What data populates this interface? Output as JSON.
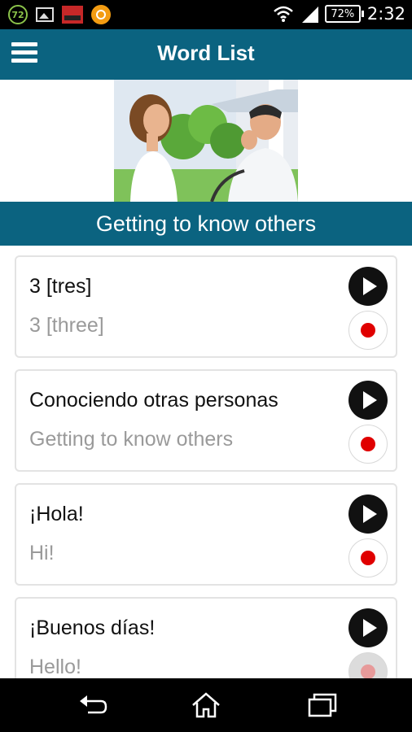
{
  "status_bar": {
    "notification_badge": "72",
    "battery": "72%",
    "time": "2:32",
    "icons": [
      "badge-72-icon",
      "gallery-icon",
      "book-app-icon",
      "orange-app-icon",
      "wifi-icon",
      "signal-icon",
      "battery-icon"
    ]
  },
  "app_bar": {
    "title": "Word List",
    "menu_icon": "hamburger-menu-icon"
  },
  "section": {
    "title": "Getting to know others"
  },
  "words": [
    {
      "spanish": "3 [tres]",
      "english": "3 [three]"
    },
    {
      "spanish": "Conociendo otras personas",
      "english": "Getting to know others"
    },
    {
      "spanish": "¡Hola!",
      "english": "Hi!"
    },
    {
      "spanish": "¡Buenos días!",
      "english": "Hello!"
    }
  ],
  "colors": {
    "primary": "#0b6380",
    "record_red": "#e00000",
    "card_border": "#e3e3e3",
    "subtext": "#9a9a9a"
  },
  "nav_bar": {
    "icons": [
      "back-icon",
      "home-icon",
      "recent-apps-icon"
    ]
  }
}
